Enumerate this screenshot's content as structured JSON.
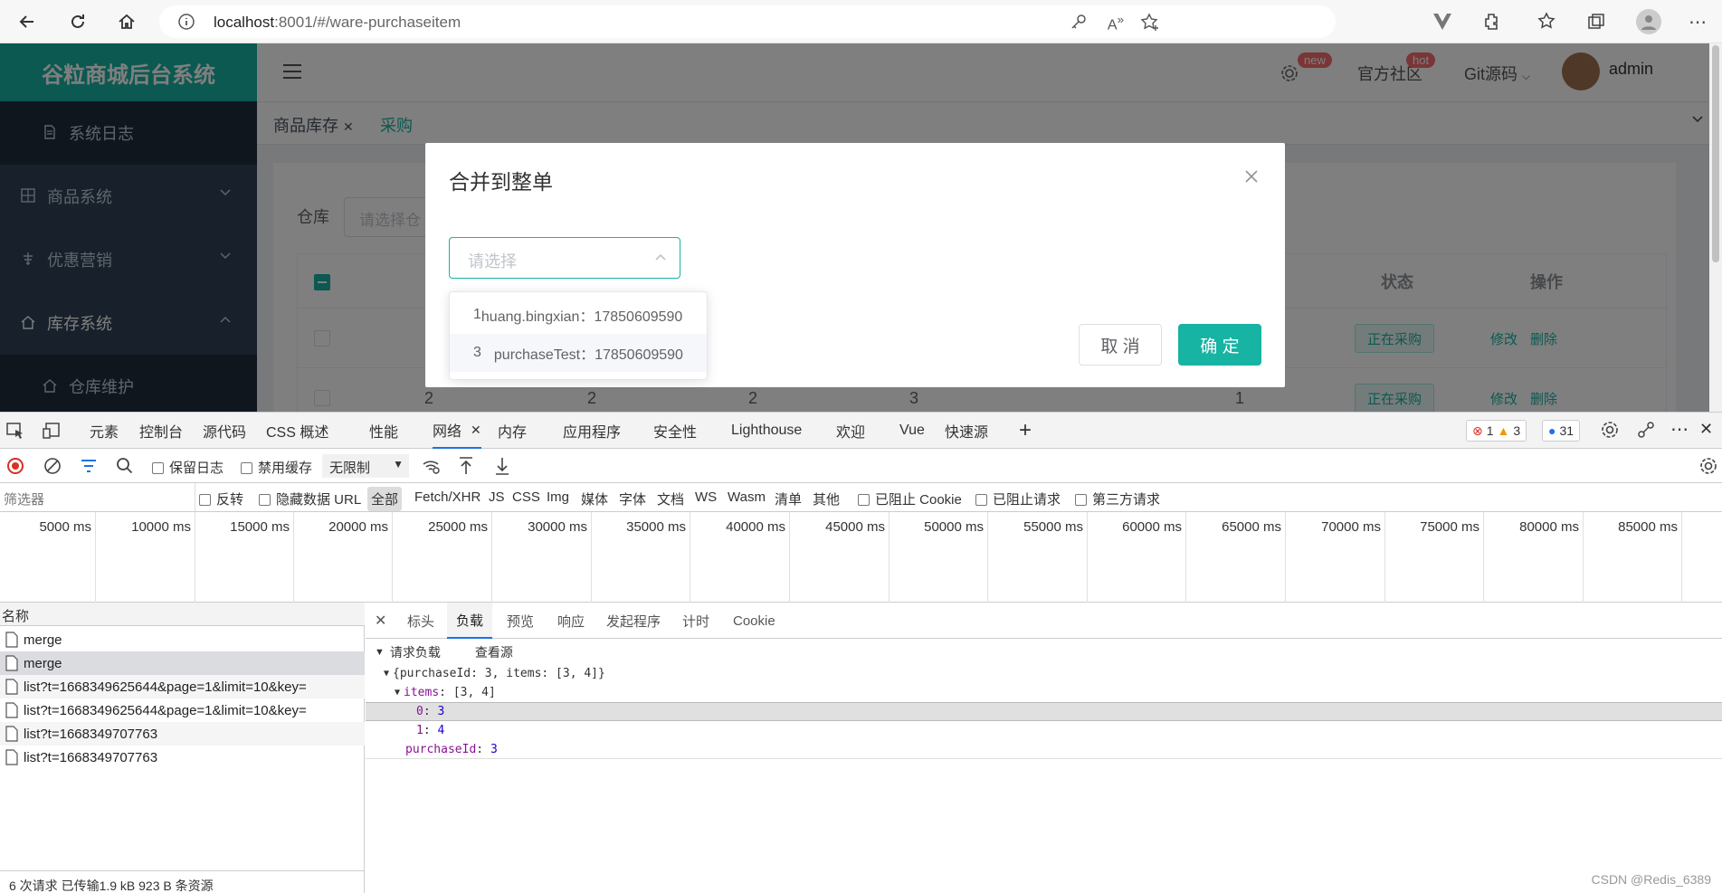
{
  "browser": {
    "url_host": "localhost",
    "url_path": ":8001/#/ware-purchaseitem"
  },
  "app": {
    "logo": "谷粒商城后台系统",
    "sidebar": {
      "items": [
        {
          "label": "系统日志",
          "icon": "document-icon",
          "sub": true
        },
        {
          "label": "商品系统",
          "icon": "grid-icon"
        },
        {
          "label": "优惠营销",
          "icon": "tag-icon"
        },
        {
          "label": "库存系统",
          "icon": "home-icon"
        },
        {
          "label": "仓库维护",
          "icon": "home-icon",
          "sub": true
        }
      ]
    },
    "header": {
      "badge_new": "new",
      "community": "官方社区",
      "badge_hot": "hot",
      "git": "Git源码",
      "user": "admin"
    },
    "tabs": {
      "tab1": "商品库存",
      "tab2": "采购"
    },
    "filter": {
      "label": "仓库",
      "placeholder": "请选择仓"
    },
    "table": {
      "col_status": "状态",
      "col_ops": "操作",
      "rows": [
        {
          "cells": [
            "",
            "",
            "",
            "",
            "",
            ""
          ],
          "status": "正在采购",
          "edit": "修改",
          "delete": "删除"
        },
        {
          "cells": [
            "2",
            "2",
            "2",
            "3",
            "",
            "1"
          ],
          "status": "正在采购",
          "edit": "修改",
          "delete": "删除"
        }
      ]
    }
  },
  "dialog": {
    "title": "合并到整单",
    "select_placeholder": "请选择",
    "options": [
      {
        "id": "1",
        "text": "huang.bingxian：17850609590"
      },
      {
        "id": "3",
        "text": "purchaseTest：17850609590"
      }
    ],
    "cancel": "取 消",
    "confirm": "确 定"
  },
  "devtools": {
    "tabs": [
      "元素",
      "控制台",
      "源代码",
      "CSS 概述",
      "性能",
      "网络",
      "内存",
      "应用程序",
      "安全性",
      "Lighthouse",
      "欢迎",
      "Vue",
      "快速源"
    ],
    "active_tab": "网络",
    "errors": "1",
    "warnings": "3",
    "messages": "31",
    "toolbar": {
      "preserve_log": "保留日志",
      "disable_cache": "禁用缓存",
      "throttle": "无限制"
    },
    "filter": {
      "label": "筛选器",
      "invert": "反转",
      "hide_data_urls": "隐藏数据 URL",
      "types": [
        "全部",
        "Fetch/XHR",
        "JS",
        "CSS",
        "Img",
        "媒体",
        "字体",
        "文档",
        "WS",
        "Wasm",
        "清单",
        "其他"
      ],
      "blocked_cookies": "已阻止 Cookie",
      "blocked_requests": "已阻止请求",
      "third_party": "第三方请求"
    },
    "timeline_ticks": [
      "5000 ms",
      "10000 ms",
      "15000 ms",
      "20000 ms",
      "25000 ms",
      "30000 ms",
      "35000 ms",
      "40000 ms",
      "45000 ms",
      "50000 ms",
      "55000 ms",
      "60000 ms",
      "65000 ms",
      "70000 ms",
      "75000 ms",
      "80000 ms",
      "85000 ms"
    ],
    "name_header": "名称",
    "requests": [
      "merge",
      "merge",
      "list?t=1668349625644&page=1&limit=10&key=",
      "list?t=1668349625644&page=1&limit=10&key=",
      "list?t=1668349707763",
      "list?t=1668349707763"
    ],
    "summary": "6 次请求   已传输1.9 kB   923 B 条资源",
    "panel_tabs": [
      "标头",
      "负载",
      "预览",
      "响应",
      "发起程序",
      "计时",
      "Cookie"
    ],
    "active_panel": "负载",
    "payload": {
      "section": "请求负载",
      "view_source": "查看源",
      "summary": "{purchaseId: 3, items: [3, 4]}",
      "items_key": "items",
      "items_val": "[3, 4]",
      "item0_key": "0",
      "item0_val": "3",
      "item1_key": "1",
      "item1_val": "4",
      "pid_key": "purchaseId",
      "pid_val": "3"
    },
    "watermark": "CSDN @Redis_6389"
  }
}
